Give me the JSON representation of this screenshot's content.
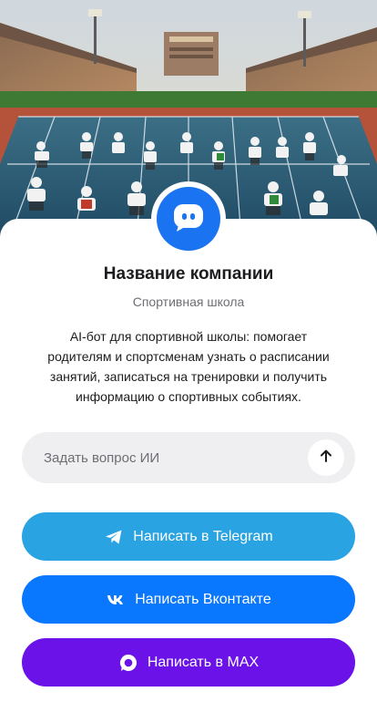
{
  "profile": {
    "company_name": "Название компании",
    "category": "Спортивная школа",
    "description": "AI-бот для спортивной школы: помогает родителям и спортсменам узнать о расписании занятий, записаться на тренировки и получить информацию о спортивных событиях.",
    "avatar_icon": "chat-bot-icon"
  },
  "hero": {
    "image": "stadium-running-track-illustration"
  },
  "ask": {
    "placeholder": "Задать вопрос ИИ",
    "send_icon": "arrow-up-icon"
  },
  "buttons": [
    {
      "label": "Написать в Telegram",
      "icon": "telegram-icon",
      "color": "#2aa3e2"
    },
    {
      "label": "Написать Вконтакте",
      "icon": "vk-icon",
      "color": "#0a77ff"
    },
    {
      "label": "Написать в MAX",
      "icon": "max-icon",
      "color": "#6a12e8"
    }
  ],
  "colors": {
    "accent": "#1a73f0",
    "text": "#1c1c1e",
    "muted": "#6e6e73",
    "input_bg": "#efeff1"
  }
}
